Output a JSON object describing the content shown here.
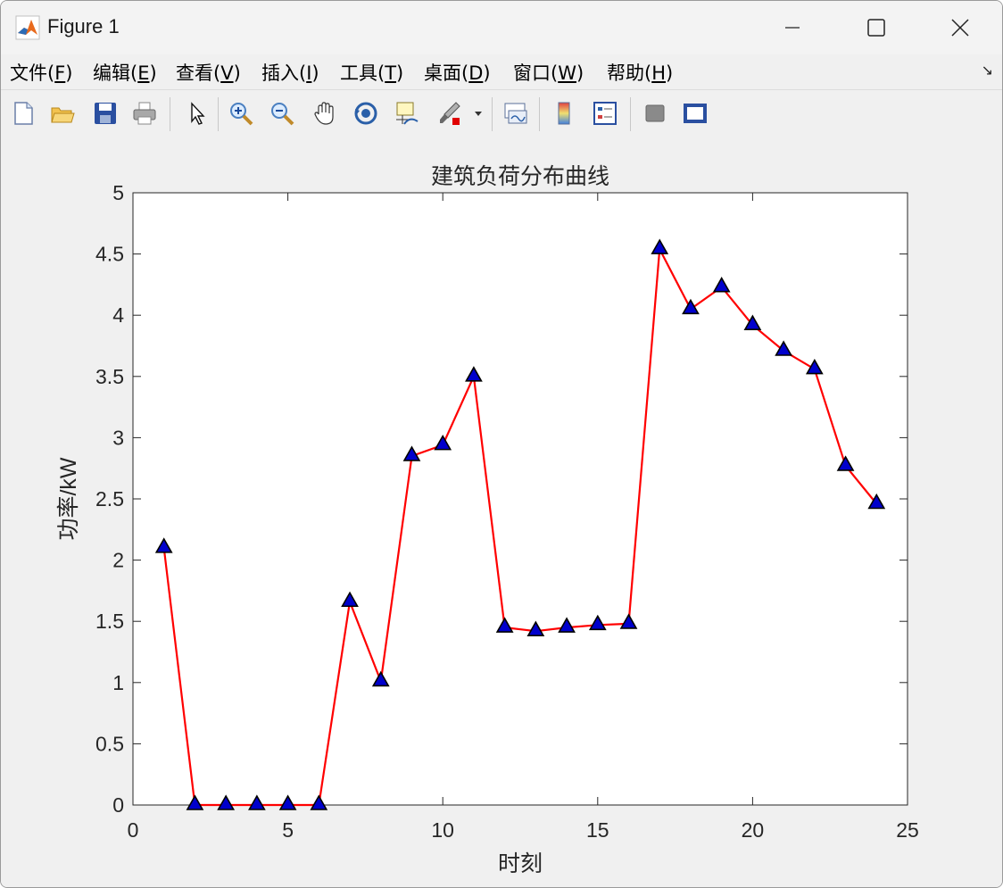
{
  "window": {
    "title": "Figure 1"
  },
  "menu": {
    "items": [
      {
        "label": "文件(",
        "key": "F",
        "tail": ")"
      },
      {
        "label": "编辑(",
        "key": "E",
        "tail": ")"
      },
      {
        "label": "查看(",
        "key": "V",
        "tail": ")"
      },
      {
        "label": "插入(",
        "key": "I",
        "tail": ")"
      },
      {
        "label": "工具(",
        "key": "T",
        "tail": ")"
      },
      {
        "label": "桌面(",
        "key": "D",
        "tail": ")"
      },
      {
        "label": "窗口(",
        "key": "W",
        "tail": ")"
      },
      {
        "label": "帮助(",
        "key": "H",
        "tail": ")"
      }
    ]
  },
  "toolbar": {
    "buttons": [
      "new-figure-icon",
      "open-file-icon",
      "save-icon",
      "print-icon",
      "pointer-icon",
      "zoom-in-icon",
      "zoom-out-icon",
      "pan-hand-icon",
      "rotate-3d-icon",
      "data-cursor-icon",
      "brush-icon",
      "link-plot-icon",
      "colorbar-icon",
      "legend-icon",
      "hide-plot-tools-icon",
      "show-plot-tools-icon"
    ]
  },
  "chart_data": {
    "type": "line",
    "title": "建筑负荷分布曲线",
    "xlabel": "时刻",
    "ylabel": "功率/kW",
    "xlim": [
      0,
      25
    ],
    "ylim": [
      0,
      5
    ],
    "xticks": [
      "0",
      "5",
      "10",
      "15",
      "20",
      "25"
    ],
    "yticks": [
      "0",
      "0.5",
      "1",
      "1.5",
      "2",
      "2.5",
      "3",
      "3.5",
      "4",
      "4.5",
      "5"
    ],
    "x": [
      1,
      2,
      3,
      4,
      5,
      6,
      7,
      8,
      9,
      10,
      11,
      12,
      13,
      14,
      15,
      16,
      17,
      18,
      19,
      20,
      21,
      22,
      23,
      24
    ],
    "series": [
      {
        "values": [
          2.1,
          0,
          0,
          0,
          0,
          0,
          1.66,
          1.01,
          2.85,
          2.94,
          3.5,
          1.45,
          1.42,
          1.45,
          1.47,
          1.48,
          4.54,
          4.05,
          4.23,
          3.92,
          3.71,
          3.56,
          2.77,
          2.46
        ],
        "color": "#ff0000",
        "marker": "triangle",
        "marker_face": "#0000cc"
      }
    ],
    "grid": false
  }
}
